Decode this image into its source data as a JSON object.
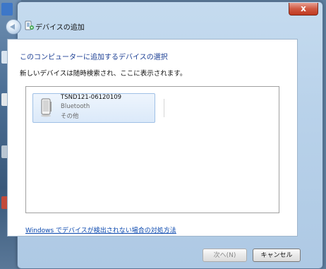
{
  "window": {
    "title": "デバイスの追加",
    "close_label": "x"
  },
  "content": {
    "heading": "このコンピューターに追加するデバイスの選択",
    "subtext": "新しいデバイスは随時検索され、ここに表示されます。"
  },
  "devices": [
    {
      "name": "TSND121-06120109",
      "type": "Bluetooth",
      "category": "その他",
      "icon": "device-icon"
    }
  ],
  "help_link": "Windows でデバイスが検出されない場合の対処方法",
  "buttons": {
    "next": "次へ(N)",
    "cancel": "キャンセル"
  },
  "colors": {
    "heading": "#1c3f94",
    "link": "#0645ad",
    "tile_bg": "#dbe9f9",
    "close_button": "#c0391f"
  }
}
